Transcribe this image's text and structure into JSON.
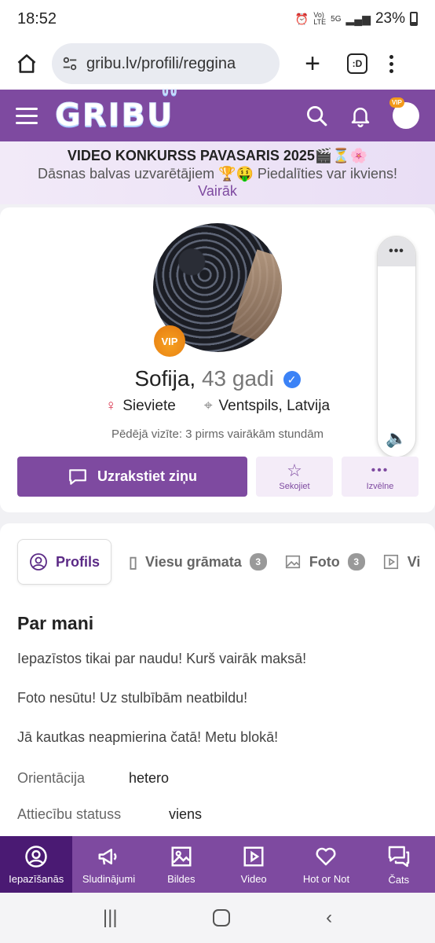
{
  "status": {
    "time": "18:52",
    "battery": "23%",
    "network": "5G"
  },
  "browser": {
    "url": "gribu.lv/profili/reggina",
    "tabs_label": ":D"
  },
  "site": {
    "logo": "GRIBU"
  },
  "banner": {
    "line1": "VIDEO KONKURSS PAVASARIS 2025🎬⏳🌸",
    "line2": "Dāsnas balvas uzvarētājiem 🏆🤑 Piedalīties var ikviens!",
    "more": "Vairāk"
  },
  "profile": {
    "vip": "VIP",
    "name": "Sofija,",
    "age": "43 gadi",
    "gender": "Sieviete",
    "location": "Ventspils, Latvija",
    "last_visit": "Pēdējā vizīte: 3 pirms vairākām stundām",
    "write_button": "Uzrakstiet ziņu",
    "follow_button": "Sekojiet",
    "menu_button": "Izvēlne"
  },
  "tabs": [
    {
      "label": "Profils"
    },
    {
      "label": "Viesu grāmata",
      "count": "3"
    },
    {
      "label": "Foto",
      "count": "3"
    },
    {
      "label": "Vi"
    }
  ],
  "about": {
    "title": "Par mani",
    "paragraphs": [
      "Iepazīstos tikai par naudu! Kurš vairāk maksā!",
      "Foto nesūtu! Uz stulbībām neatbildu!",
      "Jā kautkas neapmierina čatā! Metu blokā!"
    ],
    "attributes": [
      {
        "label": "Orientācija",
        "value": "hetero"
      },
      {
        "label": "Attiecību statuss",
        "value": "viens"
      }
    ]
  },
  "bottom_nav": [
    {
      "label": "Iepazīšanās",
      "icon": "user-circle-icon"
    },
    {
      "label": "Sludinājumi",
      "icon": "megaphone-icon"
    },
    {
      "label": "Bildes",
      "icon": "image-icon"
    },
    {
      "label": "Video",
      "icon": "play-icon"
    },
    {
      "label": "Hot or Not",
      "icon": "heart-icon"
    },
    {
      "label": "Čats",
      "icon": "chat-icon"
    }
  ],
  "colors": {
    "brand": "#7e4aa0",
    "brand_dark": "#4a1a73",
    "vip": "#f39a1a",
    "verified": "#3b82f6"
  }
}
